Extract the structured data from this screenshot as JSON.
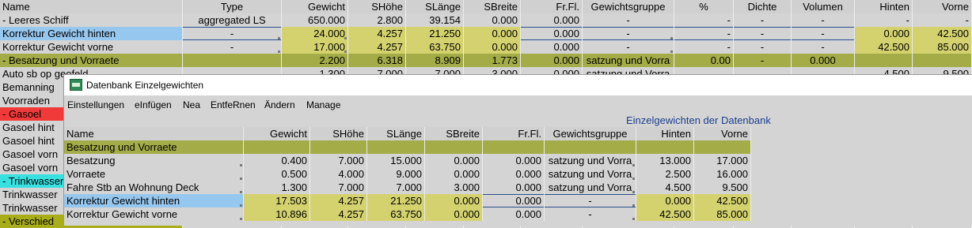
{
  "main_grid": {
    "columns": [
      "Name",
      "Type",
      "Gewicht",
      "SHöhe",
      "SLänge",
      "SBreite",
      "Fr.Fl.",
      "Gewichtsgruppe",
      "%",
      "Dichte",
      "Volumen",
      "Hinten",
      "Vorne"
    ],
    "rows": [
      {
        "cells": [
          "- Leeres Schiff",
          "aggregated LS",
          "650.000",
          "2.800",
          "39.154",
          "0.000",
          "0.000",
          "-",
          "-",
          "-",
          "-",
          "-",
          "-"
        ]
      },
      {
        "cells": [
          "Korrektur Gewicht hinten",
          "-",
          "24.000",
          "4.257",
          "21.250",
          "0.000",
          "0.000",
          "-",
          "-",
          "-",
          "-",
          "0.000",
          "42.500"
        ]
      },
      {
        "cells": [
          "Korrektur Gewicht vorne",
          "-",
          "17.000",
          "4.257",
          "63.750",
          "0.000",
          "0.000",
          "-",
          "-",
          "-",
          "-",
          "42.500",
          "85.000"
        ]
      },
      {
        "cells": [
          "- Besatzung und Vorraete",
          "",
          "2.200",
          "6.318",
          "8.909",
          "1.773",
          "0.000",
          "satzung und Vorra",
          "0.00",
          "-",
          "0.000",
          "",
          ""
        ]
      },
      {
        "cells": [
          "Auto sb op geofeld",
          "",
          "1.300",
          "7.000",
          "7.000",
          "3.000",
          "0.000",
          "satzung und Vorra",
          "",
          "",
          "",
          "4.500",
          "9.500"
        ]
      },
      {
        "cells": [
          "Bemanning",
          "",
          "",
          "",
          "",
          "",
          "",
          "",
          "",
          "",
          "",
          "",
          ""
        ]
      },
      {
        "cells": [
          "Voorraden",
          "",
          "",
          "",
          "",
          "",
          "",
          "",
          "",
          "",
          "",
          "",
          ""
        ]
      },
      {
        "cells": [
          "- Gasoel",
          "",
          "",
          "",
          "",
          "",
          "",
          "",
          "",
          "",
          "",
          "",
          ""
        ]
      },
      {
        "cells": [
          "Gasoel hint",
          "",
          "",
          "",
          "",
          "",
          "",
          "",
          "",
          "",
          "",
          "",
          ""
        ]
      },
      {
        "cells": [
          "Gasoel hint",
          "",
          "",
          "",
          "",
          "",
          "",
          "",
          "",
          "",
          "",
          "",
          ""
        ]
      },
      {
        "cells": [
          "Gasoel vorn",
          "",
          "",
          "",
          "",
          "",
          "",
          "",
          "",
          "",
          "",
          "",
          ""
        ]
      },
      {
        "cells": [
          "Gasoel vorn",
          "",
          "",
          "",
          "",
          "",
          "",
          "",
          "",
          "",
          "",
          "",
          ""
        ]
      },
      {
        "cells": [
          "- Trinkwasser",
          "",
          "",
          "",
          "",
          "",
          "",
          "",
          "",
          "",
          "",
          "",
          ""
        ]
      },
      {
        "cells": [
          "Trinkwasser",
          "",
          "",
          "",
          "",
          "",
          "",
          "",
          "",
          "",
          "",
          "",
          ""
        ]
      },
      {
        "cells": [
          "Trinkwasser",
          "",
          "",
          "",
          "",
          "",
          "",
          "",
          "",
          "",
          "",
          "",
          ""
        ]
      },
      {
        "cells": [
          "- Verschied",
          "",
          "",
          "",
          "",
          "",
          "",
          "",
          "",
          "",
          "",
          "",
          ""
        ]
      }
    ]
  },
  "dialog": {
    "title": "Datenbank Einzelgewichten",
    "menu": [
      "Einstellungen",
      "eInfügen",
      "Nea",
      "EntfeRnen",
      "Ändern",
      "Manage"
    ],
    "caption": "Einzelgewichten der Datenbank",
    "columns": [
      "Name",
      "Gewicht",
      "SHöhe",
      "SLänge",
      "SBreite",
      "Fr.Fl.",
      "Gewichtsgruppe",
      "Hinten",
      "Vorne"
    ],
    "rows": [
      {
        "cells": [
          "Besatzung und Vorraete",
          "",
          "",
          "",
          "",
          "",
          "",
          "",
          ""
        ]
      },
      {
        "cells": [
          "Besatzung",
          "0.400",
          "7.000",
          "15.000",
          "0.000",
          "0.000",
          "satzung und Vorra",
          "13.000",
          "17.000"
        ]
      },
      {
        "cells": [
          "Vorraete",
          "0.500",
          "4.000",
          "9.000",
          "0.000",
          "0.000",
          "satzung und Vorra",
          "2.500",
          "16.000"
        ]
      },
      {
        "cells": [
          "Fahre Stb an Wohnung Deck",
          "1.300",
          "7.000",
          "7.000",
          "3.000",
          "0.000",
          "satzung und Vorra",
          "4.500",
          "9.500"
        ]
      },
      {
        "cells": [
          "Korrektur Gewicht hinten",
          "17.503",
          "4.257",
          "21.250",
          "0.000",
          "0.000",
          "-",
          "0.000",
          "42.500"
        ]
      },
      {
        "cells": [
          "Korrektur Gewicht vorne",
          "10.896",
          "4.257",
          "63.750",
          "0.000",
          "0.000",
          "-",
          "42.500",
          "85.000"
        ]
      }
    ]
  },
  "colors": {
    "header_bg": "#d0d0d0",
    "yellow": "#d4d26e",
    "olive": "#a4ac48",
    "selection": "#96c7ef",
    "red_group": "#f03a3a",
    "cyan_group": "#38e0e0",
    "olive_group": "#a8ae1a",
    "caption_blue": "#1a3f8e"
  },
  "icons": [
    "app-database-icon"
  ]
}
